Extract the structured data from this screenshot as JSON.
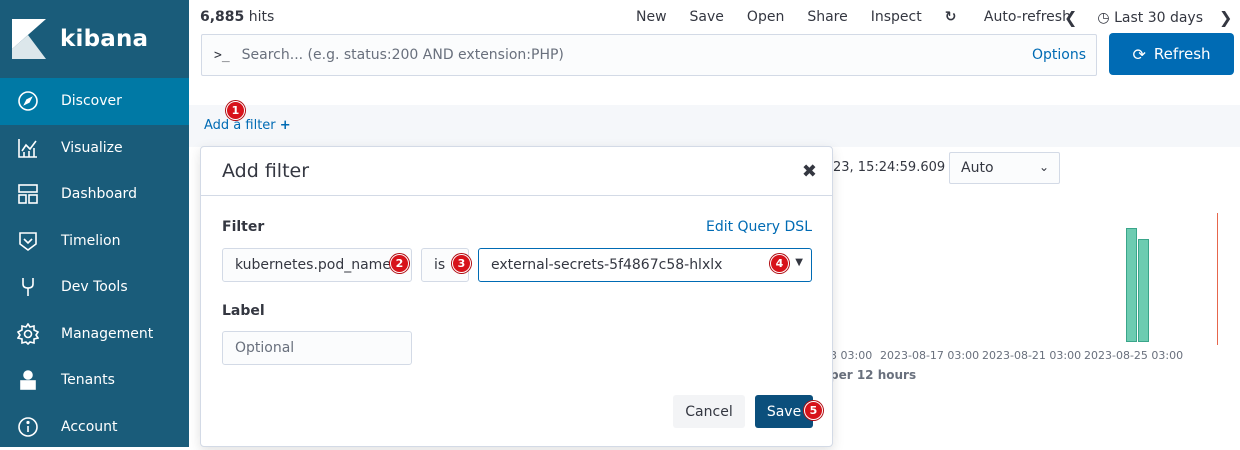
{
  "app": {
    "name": "kibana"
  },
  "sidebar": {
    "items": [
      {
        "label": "Discover",
        "icon": "compass-icon",
        "active": true
      },
      {
        "label": "Visualize",
        "icon": "chart-icon",
        "active": false
      },
      {
        "label": "Dashboard",
        "icon": "dashboard-icon",
        "active": false
      },
      {
        "label": "Timelion",
        "icon": "timelion-icon",
        "active": false
      },
      {
        "label": "Dev Tools",
        "icon": "wrench-icon",
        "active": false
      },
      {
        "label": "Management",
        "icon": "gear-icon",
        "active": false
      },
      {
        "label": "Tenants",
        "icon": "user-icon",
        "active": false
      },
      {
        "label": "Account",
        "icon": "info-icon",
        "active": false
      }
    ]
  },
  "header": {
    "hits_count": "6,885",
    "hits_label": "hits",
    "menu": [
      "New",
      "Save",
      "Open",
      "Share",
      "Inspect"
    ],
    "auto_refresh": "Auto-refresh",
    "time_range": "Last 30 days"
  },
  "search": {
    "prompt": ">_",
    "placeholder": "Search... (e.g. status:200 AND extension:PHP)",
    "options_label": "Options",
    "refresh_label": "Refresh"
  },
  "filter_bar": {
    "add_filter_label": "Add a filter"
  },
  "background": {
    "time_fragment": "23, 15:24:59.609 —",
    "interval": "Auto",
    "ticks": [
      "3 03:00",
      "2023-08-17 03:00",
      "2023-08-21 03:00",
      "2023-08-25 03:00"
    ],
    "xlabel": "per 12 hours"
  },
  "chart_data": {
    "type": "bar",
    "xlabel": "per 12 hours",
    "categories": [
      "2023-08-25 (a)",
      "2023-08-25 (b)"
    ],
    "values": [
      1,
      0.9
    ],
    "ylim": [
      0,
      1.05
    ]
  },
  "popover": {
    "title": "Add filter",
    "filter_label": "Filter",
    "edit_dsl_label": "Edit Query DSL",
    "field_value": "kubernetes.pod_name",
    "operator_value": "is",
    "value_value": "external-secrets-5f4867c58-hlxlx",
    "label_label": "Label",
    "label_placeholder": "Optional",
    "cancel_label": "Cancel",
    "save_label": "Save"
  },
  "steps": [
    "1",
    "2",
    "3",
    "4",
    "5"
  ],
  "colors": {
    "sidebar": "#1a5c7a",
    "active": "#0079a5",
    "primary": "#006bb4",
    "badge": "#d7131b",
    "bar": "#6dccb1"
  }
}
